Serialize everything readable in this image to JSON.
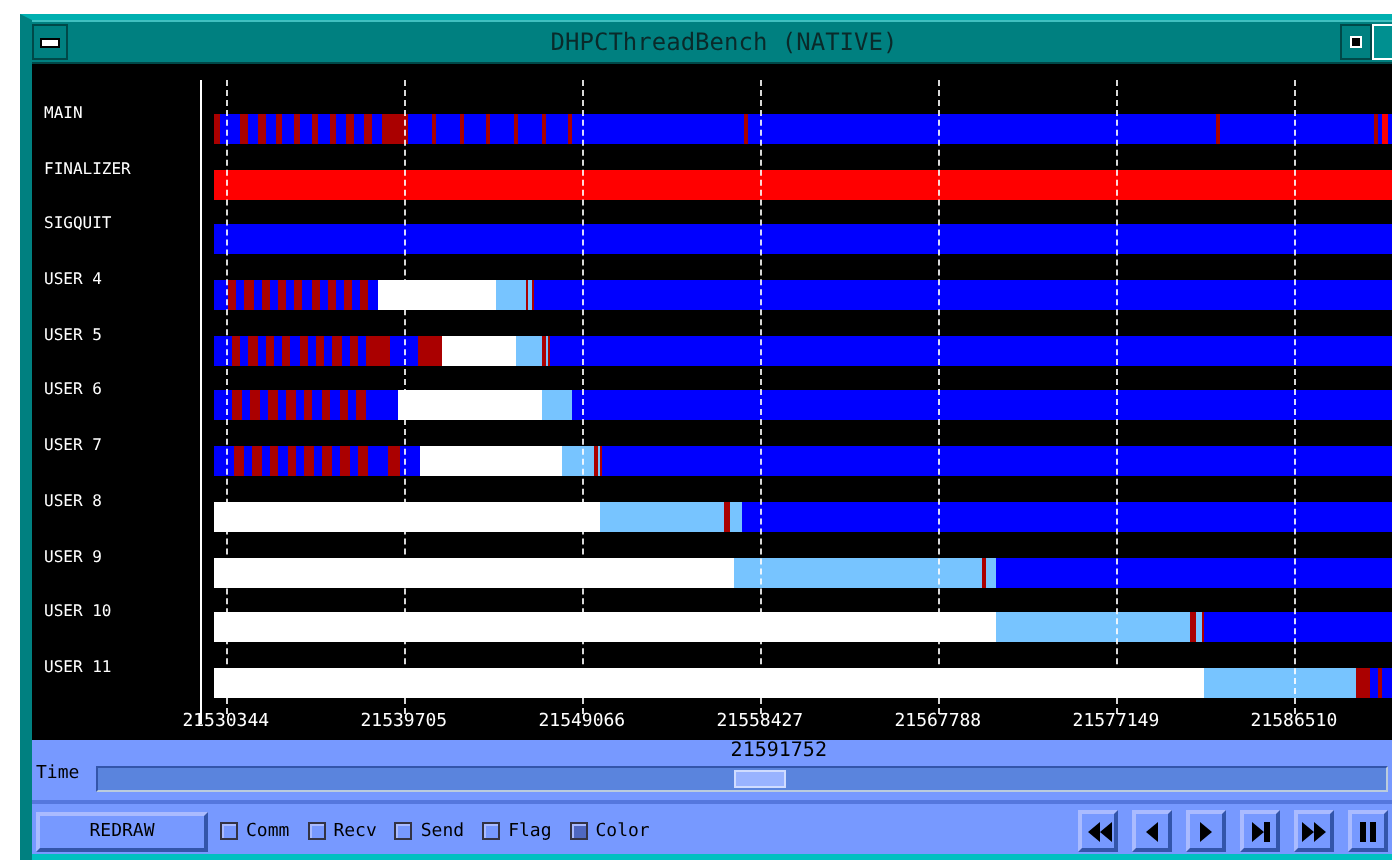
{
  "window": {
    "title": "DHPCThreadBench (NATIVE)"
  },
  "threads": [
    {
      "name": "MAIN"
    },
    {
      "name": "FINALIZER"
    },
    {
      "name": "SIGQUIT"
    },
    {
      "name": "USER 4"
    },
    {
      "name": "USER 5"
    },
    {
      "name": "USER 6"
    },
    {
      "name": "USER 7"
    },
    {
      "name": "USER 8"
    },
    {
      "name": "USER 9"
    },
    {
      "name": "USER 10"
    },
    {
      "name": "USER 11"
    }
  ],
  "axis_ticks": [
    "21530344",
    "21539705",
    "21549066",
    "21558427",
    "21567788",
    "21577149",
    "21586510"
  ],
  "time": {
    "label": "Time",
    "value": "21591752",
    "level": 0.515
  },
  "redraw_button": "REDRAW",
  "options": [
    {
      "label": "Comm",
      "checked": false
    },
    {
      "label": "Recv",
      "checked": false
    },
    {
      "label": "Send",
      "checked": false
    },
    {
      "label": "Flag",
      "checked": false
    },
    {
      "label": "Color",
      "checked": true
    }
  ],
  "playback": [
    {
      "kind": "rewind"
    },
    {
      "kind": "back"
    },
    {
      "kind": "play"
    },
    {
      "kind": "end"
    },
    {
      "kind": "forward"
    },
    {
      "kind": "pause"
    }
  ]
}
